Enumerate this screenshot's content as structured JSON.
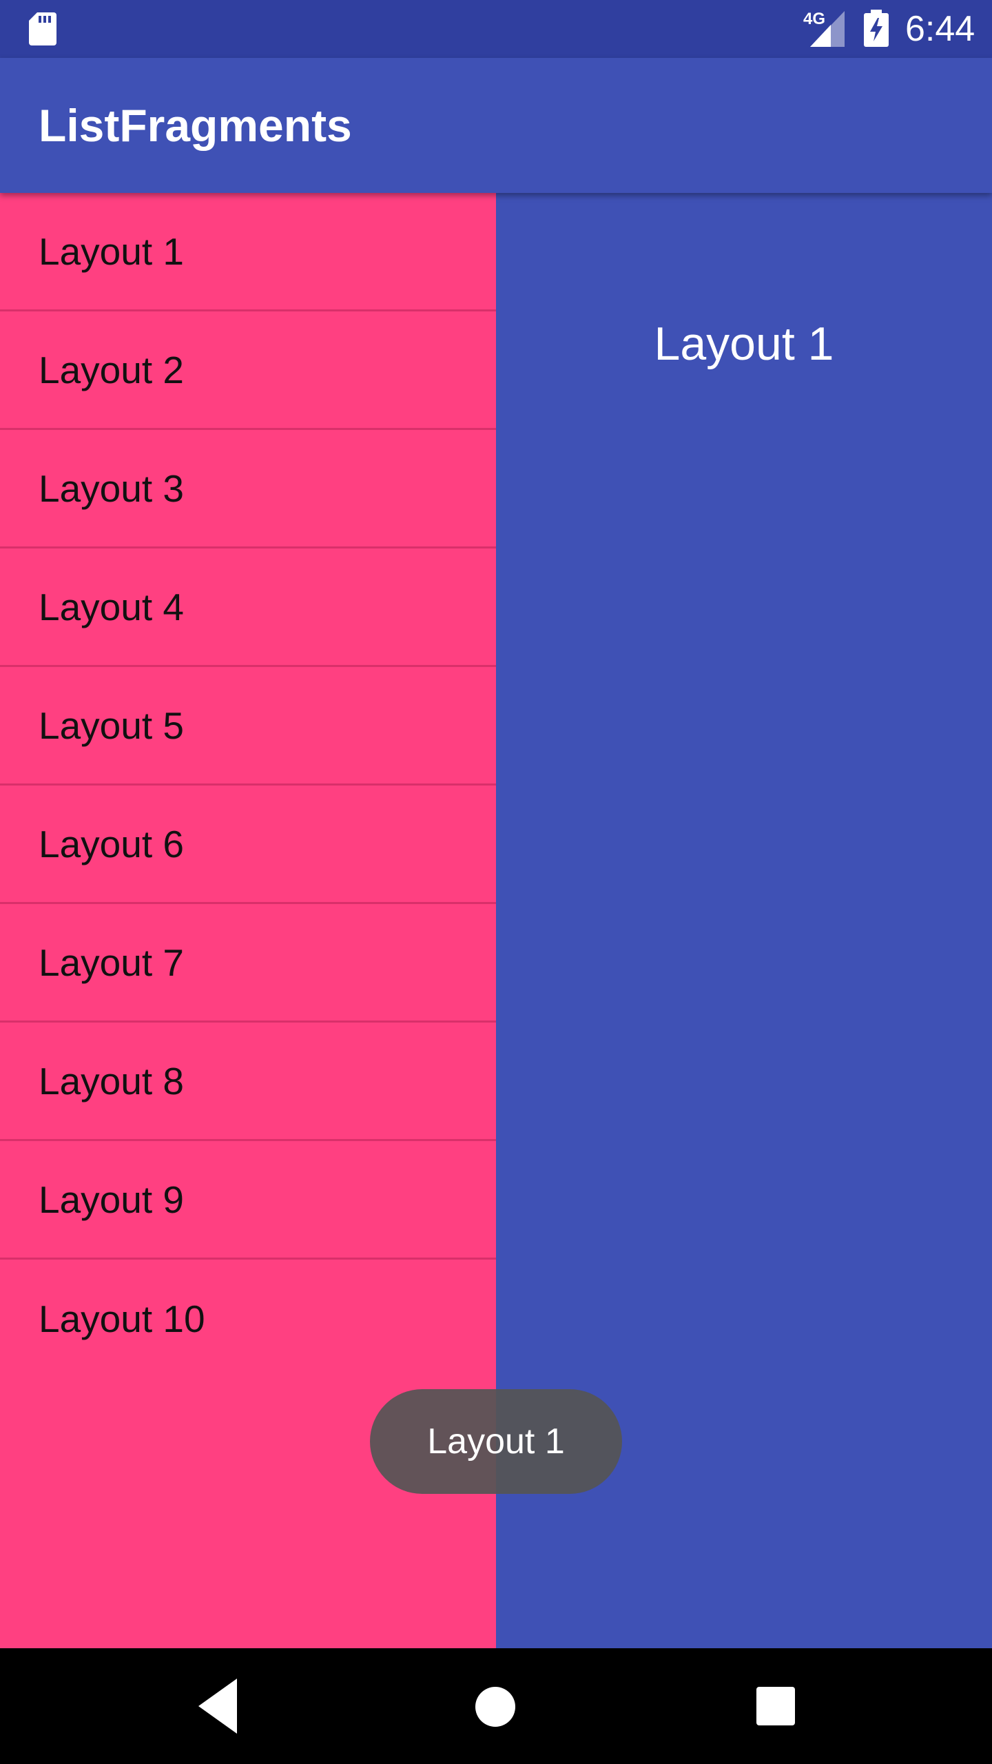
{
  "status_bar": {
    "network_label": "4G",
    "time": "6:44",
    "icons": [
      "sd-card-icon",
      "signal-icon",
      "battery-charging-icon"
    ]
  },
  "app_bar": {
    "title": "ListFragments"
  },
  "list": {
    "items": [
      {
        "label": "Layout 1"
      },
      {
        "label": "Layout 2"
      },
      {
        "label": "Layout 3"
      },
      {
        "label": "Layout 4"
      },
      {
        "label": "Layout 5"
      },
      {
        "label": "Layout 6"
      },
      {
        "label": "Layout 7"
      },
      {
        "label": "Layout 8"
      },
      {
        "label": "Layout 9"
      },
      {
        "label": "Layout 10"
      }
    ]
  },
  "detail": {
    "title": "Layout 1"
  },
  "toast": {
    "message": "Layout 1"
  },
  "colors": {
    "status_bar": "#303f9f",
    "primary": "#3f51b5",
    "accent": "#ff4081",
    "toast": "#555555"
  },
  "nav_bar": {
    "icons": [
      "back-icon",
      "home-icon",
      "recents-icon"
    ]
  }
}
